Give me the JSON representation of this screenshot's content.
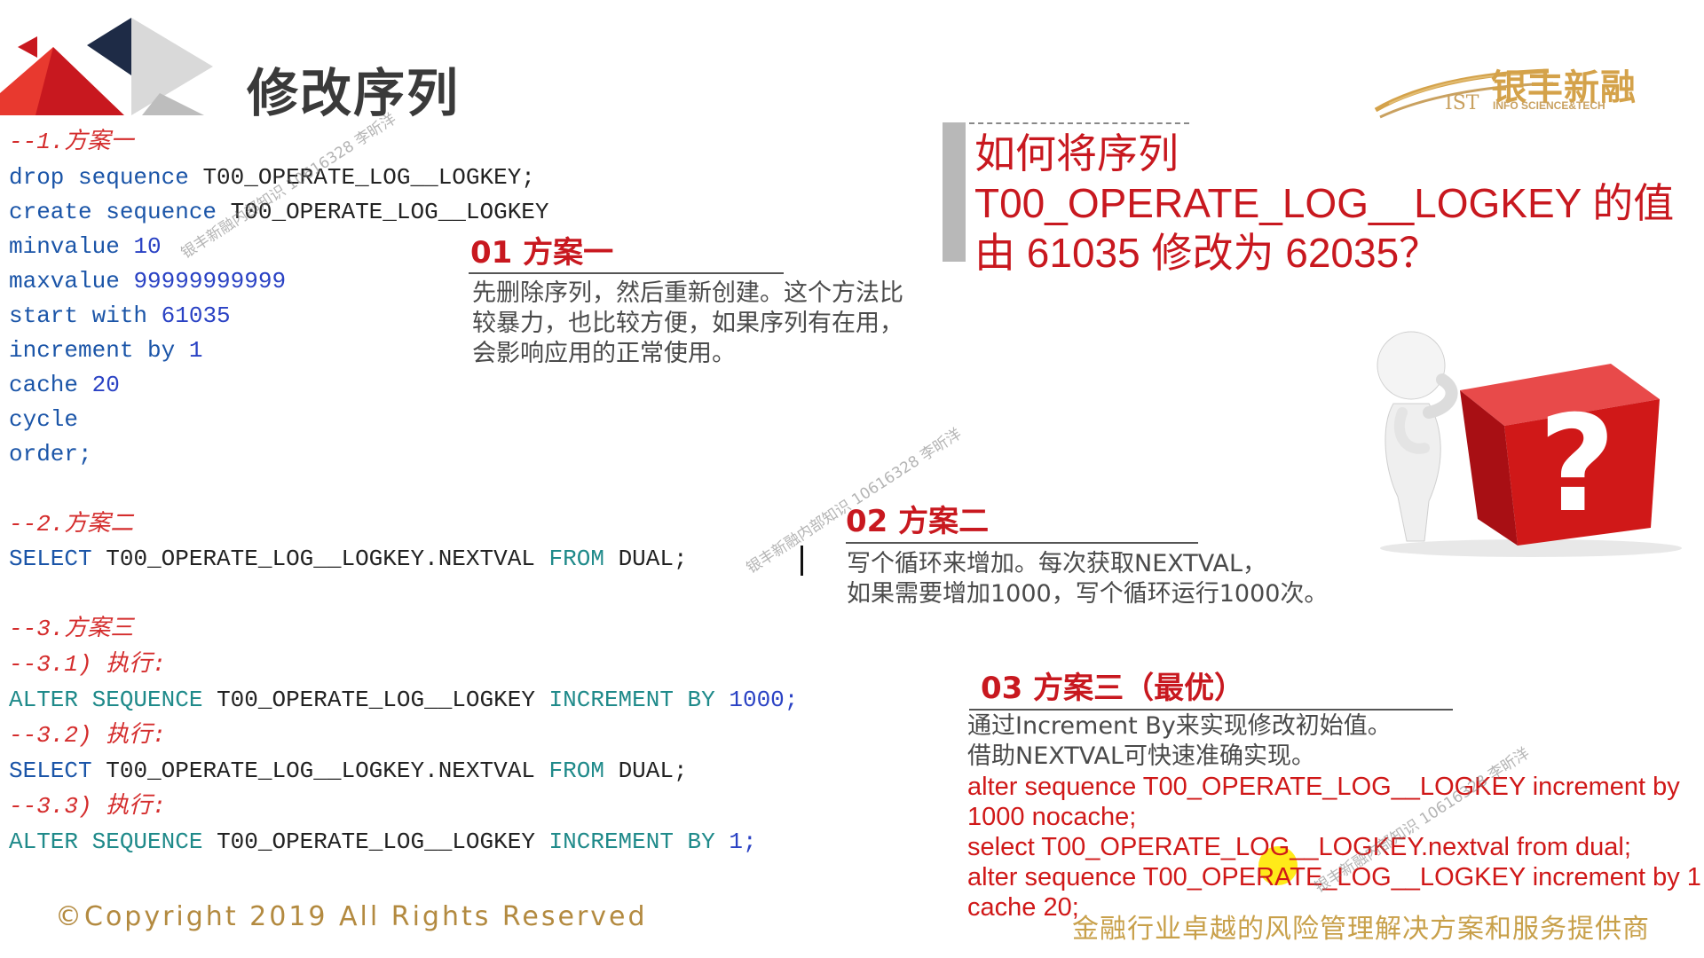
{
  "title": "修改序列",
  "brand": {
    "name": "银丰新融",
    "ist": "IST",
    "sub": "INFO SCIENCE&TECH"
  },
  "code": {
    "c1_comment": "--1.方案一",
    "l_drop_kw": "drop sequence",
    "l_drop_id": "T00_OPERATE_LOG__LOGKEY;",
    "l_create_kw": "create sequence",
    "l_create_id": "T00_OPERATE_LOG__LOGKEY",
    "l_min_kw": "minvalue",
    "l_min_val": "10",
    "l_max_kw": "maxvalue",
    "l_max_val": "99999999999",
    "l_start_kw": "start with",
    "l_start_val": "61035",
    "l_inc_kw": "increment by",
    "l_inc_val": "1",
    "l_cache_kw": "cache",
    "l_cache_val": "20",
    "l_cycle": "cycle",
    "l_order": "order;",
    "c2_comment": "--2.方案二",
    "sel_kw": "SELECT",
    "sel_id": "T00_OPERATE_LOG__LOGKEY.NEXTVAL",
    "sel_from": "FROM",
    "sel_dual": "DUAL;",
    "c3_comment": "--3.方案三",
    "c31_comment": "--3.1) 执行:",
    "alt_kw": "ALTER",
    "alt_seq": "SEQUENCE",
    "alt_id": "T00_OPERATE_LOG__LOGKEY",
    "alt_inc": "INCREMENT BY",
    "alt_val1": "1000;",
    "c32_comment": "--3.2) 执行:",
    "c33_comment": "--3.3) 执行:",
    "alt_val2": "1;"
  },
  "plan1": {
    "title": "01 方案一",
    "desc": [
      "先删除序列，然后重新创建。这个方法比",
      "较暴力，也比较方便，如果序列有在用，",
      "会影响应用的正常使用。"
    ]
  },
  "plan2": {
    "title": "02 方案二",
    "desc": [
      "写个循环来增加。每次获取NEXTVAL，",
      "如果需要增加1000，写个循环运行1000次。"
    ]
  },
  "plan3": {
    "title": "03 方案三（最优）",
    "desc": [
      "通过Increment By来实现修改初始值。",
      "借助NEXTVAL可快速准确实现。"
    ],
    "sql": [
      "alter sequence T00_OPERATE_LOG__LOGKEY increment by",
      "1000 nocache;",
      "select T00_OPERATE_LOG__LOGKEY.nextval from dual;",
      "alter sequence T00_OPERATE_LOG__LOGKEY increment by 1",
      "cache 20;"
    ]
  },
  "question": [
    "如何将序列",
    "T00_OPERATE_LOG__LOGKEY 的值",
    "由 61035 修改为 62035？"
  ],
  "copyright": "©Copyright 2019 All Rights Reserved",
  "slogan": "金融行业卓越的风险管理解决方案和服务提供商",
  "watermark": "银丰新融内部知识 10616328 李昕洋",
  "colors": {
    "accent_red": "#c8181f",
    "code_keyword": "#1b55a8",
    "code_comment": "#d42c2c",
    "gold": "#c8a04a"
  }
}
